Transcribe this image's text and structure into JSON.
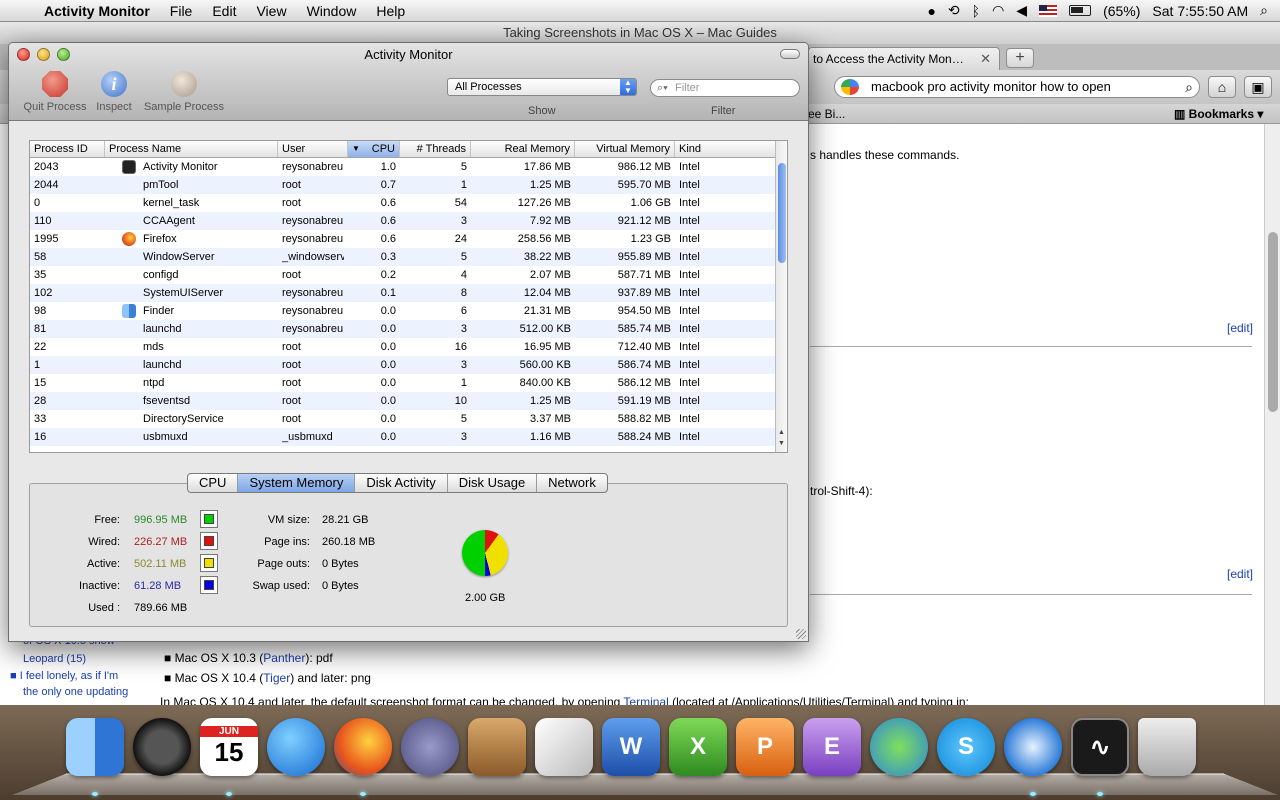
{
  "menubar": {
    "app_name": "Activity Monitor",
    "items": [
      "File",
      "Edit",
      "View",
      "Window",
      "Help"
    ],
    "battery": "(65%)",
    "clock": "Sat 7:55:50 AM"
  },
  "browser": {
    "window_title": "Taking Screenshots in Mac OS X – Mac Guides",
    "tab_title": "to Access the Activity Mon…",
    "new_tab": "+",
    "search_query": "macbook pro activity monitor how to open",
    "bookmarks_left": "ree Bi...",
    "bookmarks": "Bookmarks",
    "content": {
      "line1": "s handles these commands.",
      "edit1": "[edit]",
      "line2": "trol-Shift-4):",
      "edit2": "[edit]",
      "list1_prefix": "Mac OS X 10.3 (",
      "list1_link": "Panther",
      "list1_suffix": "): pdf",
      "list2_prefix": "Mac OS X 10.4 (",
      "list2_link": "Tiger",
      "list2_suffix": ") and later: png",
      "para_prefix": "In Mac OS X 10.4 and later, the default screenshot format can be changed, by opening ",
      "para_link": "Terminal",
      "para_suffix": " (located at /Applications/Utilities/Terminal) and typing in:",
      "sidebar_1": "of OS X 10.5 show",
      "sidebar_2": "Leopard (15)",
      "sidebar_3": "I feel lonely, as if I'm",
      "sidebar_4": "the only one updating"
    }
  },
  "activity_monitor": {
    "title": "Activity Monitor",
    "tools": {
      "quit": "Quit Process",
      "inspect": "Inspect",
      "sample": "Sample Process"
    },
    "show_select": "All Processes",
    "show_label": "Show",
    "filter_placeholder": "Filter",
    "filter_label": "Filter",
    "columns": [
      "Process ID",
      "Process Name",
      "User",
      "CPU",
      "# Threads",
      "Real Memory",
      "Virtual Memory",
      "Kind"
    ],
    "rows": [
      {
        "pid": "2043",
        "name": "Activity Monitor",
        "user": "reysonabreu",
        "cpu": "1.0",
        "threads": "5",
        "real": "17.86 MB",
        "virtual": "986.12 MB",
        "kind": "Intel",
        "icon": "activity-monitor-icon"
      },
      {
        "pid": "2044",
        "name": "pmTool",
        "user": "root",
        "cpu": "0.7",
        "threads": "1",
        "real": "1.25 MB",
        "virtual": "595.70 MB",
        "kind": "Intel"
      },
      {
        "pid": "0",
        "name": "kernel_task",
        "user": "root",
        "cpu": "0.6",
        "threads": "54",
        "real": "127.26 MB",
        "virtual": "1.06 GB",
        "kind": "Intel"
      },
      {
        "pid": "110",
        "name": "CCAAgent",
        "user": "reysonabreu",
        "cpu": "0.6",
        "threads": "3",
        "real": "7.92 MB",
        "virtual": "921.12 MB",
        "kind": "Intel"
      },
      {
        "pid": "1995",
        "name": "Firefox",
        "user": "reysonabreu",
        "cpu": "0.6",
        "threads": "24",
        "real": "258.56 MB",
        "virtual": "1.23 GB",
        "kind": "Intel",
        "icon": "firefox-icon"
      },
      {
        "pid": "58",
        "name": "WindowServer",
        "user": "_windowserver",
        "cpu": "0.3",
        "threads": "5",
        "real": "38.22 MB",
        "virtual": "955.89 MB",
        "kind": "Intel"
      },
      {
        "pid": "35",
        "name": "configd",
        "user": "root",
        "cpu": "0.2",
        "threads": "4",
        "real": "2.07 MB",
        "virtual": "587.71 MB",
        "kind": "Intel"
      },
      {
        "pid": "102",
        "name": "SystemUIServer",
        "user": "reysonabreu",
        "cpu": "0.1",
        "threads": "8",
        "real": "12.04 MB",
        "virtual": "937.89 MB",
        "kind": "Intel"
      },
      {
        "pid": "98",
        "name": "Finder",
        "user": "reysonabreu",
        "cpu": "0.0",
        "threads": "6",
        "real": "21.31 MB",
        "virtual": "954.50 MB",
        "kind": "Intel",
        "icon": "finder-icon"
      },
      {
        "pid": "81",
        "name": "launchd",
        "user": "reysonabreu",
        "cpu": "0.0",
        "threads": "3",
        "real": "512.00 KB",
        "virtual": "585.74 MB",
        "kind": "Intel"
      },
      {
        "pid": "22",
        "name": "mds",
        "user": "root",
        "cpu": "0.0",
        "threads": "16",
        "real": "16.95 MB",
        "virtual": "712.40 MB",
        "kind": "Intel"
      },
      {
        "pid": "1",
        "name": "launchd",
        "user": "root",
        "cpu": "0.0",
        "threads": "3",
        "real": "560.00 KB",
        "virtual": "586.74 MB",
        "kind": "Intel"
      },
      {
        "pid": "15",
        "name": "ntpd",
        "user": "root",
        "cpu": "0.0",
        "threads": "1",
        "real": "840.00 KB",
        "virtual": "586.12 MB",
        "kind": "Intel"
      },
      {
        "pid": "28",
        "name": "fseventsd",
        "user": "root",
        "cpu": "0.0",
        "threads": "10",
        "real": "1.25 MB",
        "virtual": "591.19 MB",
        "kind": "Intel"
      },
      {
        "pid": "33",
        "name": "DirectoryService",
        "user": "root",
        "cpu": "0.0",
        "threads": "5",
        "real": "3.37 MB",
        "virtual": "588.82 MB",
        "kind": "Intel"
      },
      {
        "pid": "16",
        "name": "usbmuxd",
        "user": "_usbmuxd",
        "cpu": "0.0",
        "threads": "3",
        "real": "1.16 MB",
        "virtual": "588.24 MB",
        "kind": "Intel"
      }
    ],
    "tabs": [
      "CPU",
      "System Memory",
      "Disk Activity",
      "Disk Usage",
      "Network"
    ],
    "active_tab": "System Memory",
    "memory": {
      "free_label": "Free:",
      "free": "996.95 MB",
      "wired_label": "Wired:",
      "wired": "226.27 MB",
      "active_label": "Active:",
      "active": "502.11 MB",
      "inactive_label": "Inactive:",
      "inactive": "61.28 MB",
      "used_label": "Used :",
      "used": "789.66 MB",
      "vm_label": "VM size:",
      "vm": "28.21 GB",
      "pageins_label": "Page ins:",
      "pageins": "260.18 MB",
      "pageouts_label": "Page outs:",
      "pageouts": "0 Bytes",
      "swap_label": "Swap used:",
      "swap": "0 Bytes",
      "total": "2.00 GB",
      "pie_fractions": {
        "free": 0.5,
        "wired": 0.1,
        "active": 0.36,
        "inactive": 0.04
      }
    },
    "colors": {
      "free": "#00d000",
      "wired": "#e01010",
      "active": "#f0e000",
      "inactive": "#0000e0",
      "free_text": "#2a8a2a",
      "wired_text": "#b02020",
      "active_text": "#8c8830",
      "inactive_text": "#2a2aa0"
    }
  },
  "dock": {
    "calendar_month": "JUN",
    "calendar_day": "15",
    "items": [
      "finder-icon",
      "dashboard-icon",
      "ical-icon",
      "itunes-icon",
      "firefox-icon",
      "script-editor-icon",
      "keynote-icon",
      "numbers-icon",
      "word-icon",
      "excel-icon",
      "powerpoint-icon",
      "entourage-icon",
      "messenger-icon",
      "skype-icon",
      "safari-icon",
      "activity-monitor-icon",
      "trash-icon"
    ]
  }
}
